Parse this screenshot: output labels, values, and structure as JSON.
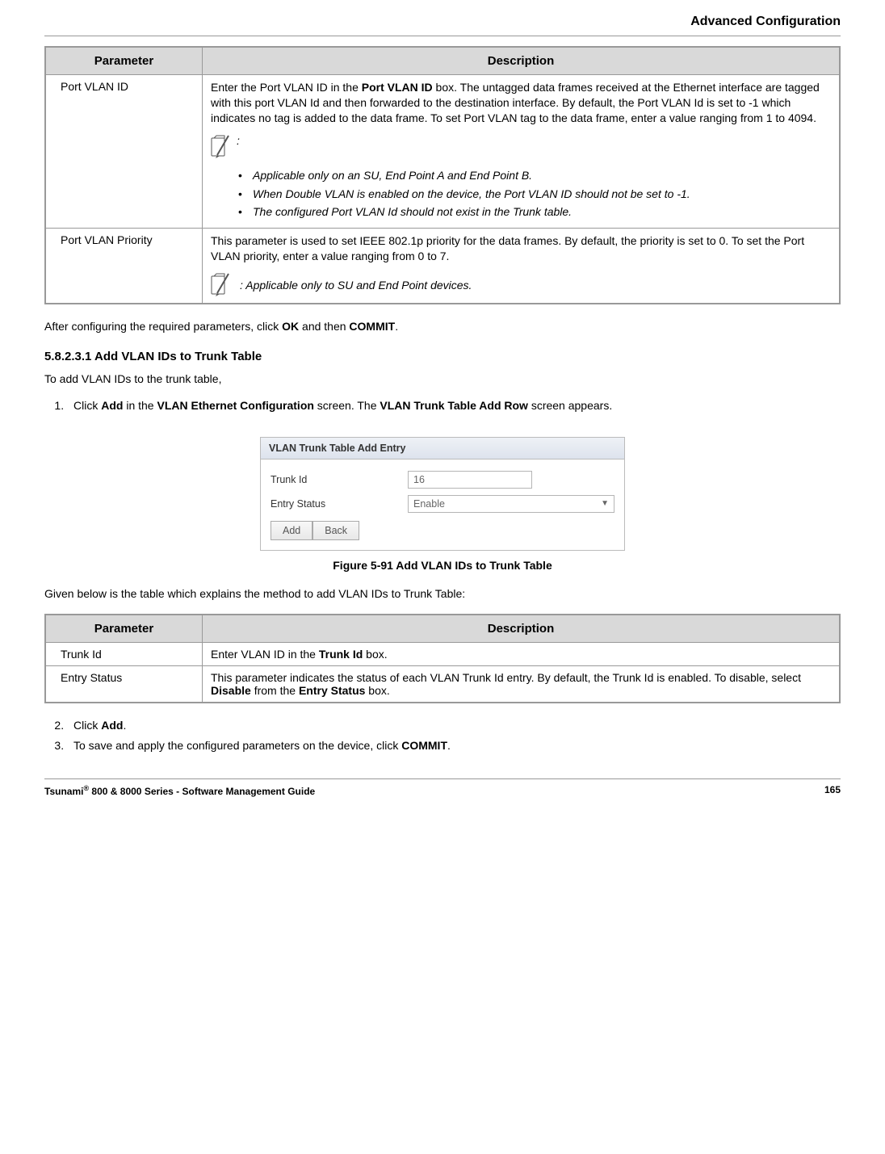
{
  "header": {
    "title": "Advanced Configuration"
  },
  "table1": {
    "headers": {
      "param": "Parameter",
      "desc": "Description"
    },
    "rows": [
      {
        "name": "Port VLAN ID",
        "main_pre": "Enter the Port VLAN ID in the ",
        "main_bold1": "Port VLAN ID",
        "main_post": " box. The untagged data frames received at the Ethernet interface are tagged with this port VLAN Id and then forwarded to the destination interface. By default, the Port VLAN Id is set to -1 which indicates no tag is added to the data frame. To set Port VLAN tag to the data frame, enter a value ranging from 1 to 4094.",
        "note_colon": ":",
        "bullets": [
          "Applicable only on an SU, End Point A and End Point B.",
          "When Double VLAN is enabled on the device, the Port VLAN ID should not be set to -1.",
          "The configured Port VLAN Id should not exist in the Trunk table."
        ]
      },
      {
        "name": "Port VLAN Priority",
        "main": "This parameter is used to set IEEE 802.1p priority for the data frames. By default, the priority is set to 0. To set the Port VLAN priority, enter a value ranging from 0 to 7.",
        "note_inline": ": Applicable only to SU and End Point devices."
      }
    ]
  },
  "after_table1": {
    "pre": "After configuring the required parameters, click ",
    "b1": "OK",
    "mid": " and then ",
    "b2": "COMMIT",
    "post": "."
  },
  "section": {
    "heading": "5.8.2.3.1 Add VLAN IDs to Trunk Table",
    "intro": "To add VLAN IDs to the trunk table,",
    "step1": {
      "pre": "Click ",
      "b1": "Add",
      "mid1": " in the ",
      "b2": "VLAN Ethernet Configuration",
      "mid2": " screen. The ",
      "b3": "VLAN Trunk Table Add Row",
      "post": " screen appears."
    }
  },
  "ui": {
    "title": "VLAN Trunk Table Add Entry",
    "rows": {
      "trunk_label": "Trunk Id",
      "trunk_value": "16",
      "status_label": "Entry Status",
      "status_value": "Enable"
    },
    "buttons": {
      "add": "Add",
      "back": "Back"
    }
  },
  "figure_caption": "Figure 5-91 Add VLAN IDs to Trunk Table",
  "below_figure": "Given below is the table which explains the method to add VLAN IDs to Trunk Table:",
  "table2": {
    "headers": {
      "param": "Parameter",
      "desc": "Description"
    },
    "rows": [
      {
        "name": "Trunk Id",
        "pre": "Enter VLAN ID in the ",
        "b1": "Trunk Id",
        "post": " box."
      },
      {
        "name": "Entry Status",
        "pre": "This parameter indicates the status of each VLAN Trunk Id entry. By default, the Trunk Id is enabled. To disable, select ",
        "b1": "Disable",
        "mid": " from the ",
        "b2": "Entry Status",
        "post": " box."
      }
    ]
  },
  "steps_after": {
    "step2": {
      "pre": "Click ",
      "b1": "Add",
      "post": "."
    },
    "step3": {
      "pre": "To save and apply the configured parameters on the device, click ",
      "b1": "COMMIT",
      "post": "."
    }
  },
  "footer": {
    "left_pre": "Tsunami",
    "left_sup": "®",
    "left_post": " 800 & 8000 Series - Software Management Guide",
    "page": "165"
  }
}
